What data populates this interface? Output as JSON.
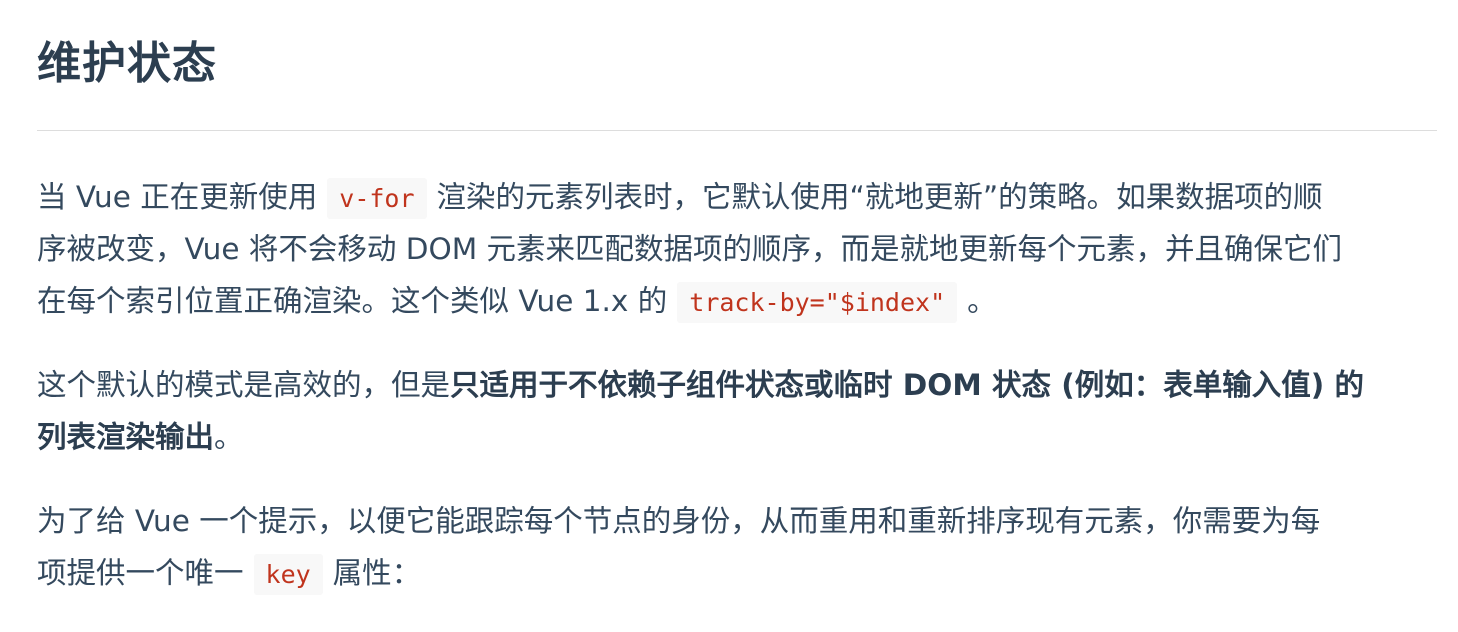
{
  "heading": "维护状态",
  "paragraph1": {
    "line1_pre": "当 Vue 正在更新使用",
    "line1_code": "v-for",
    "line1_post": "渲染的元素列表时，它默认使用“就地更新”的策略。如果数据项的顺",
    "line2": "序被改变，Vue 将不会移动 DOM 元素来匹配数据项的顺序，而是就地更新每个元素，并且确保它们",
    "line3_pre": "在每个索引位置正确渲染。这个类似 Vue 1.x 的",
    "line3_code": "track-by=\"$index\"",
    "line3_post": "。"
  },
  "paragraph2": {
    "line1_pre": "这个默认的模式是高效的，但是",
    "line1_bold": "只适用于不依赖子组件状态或临时 DOM 状态 (例如：表单输入值) 的",
    "line2_bold": "列表渲染输出",
    "line2_post": "。"
  },
  "paragraph3": {
    "line1": "为了给 Vue 一个提示，以便它能跟踪每个节点的身份，从而重用和重新排序现有元素，你需要为每",
    "line2_pre": "项提供一个唯一",
    "line2_code": "key",
    "line2_post": "属性："
  }
}
